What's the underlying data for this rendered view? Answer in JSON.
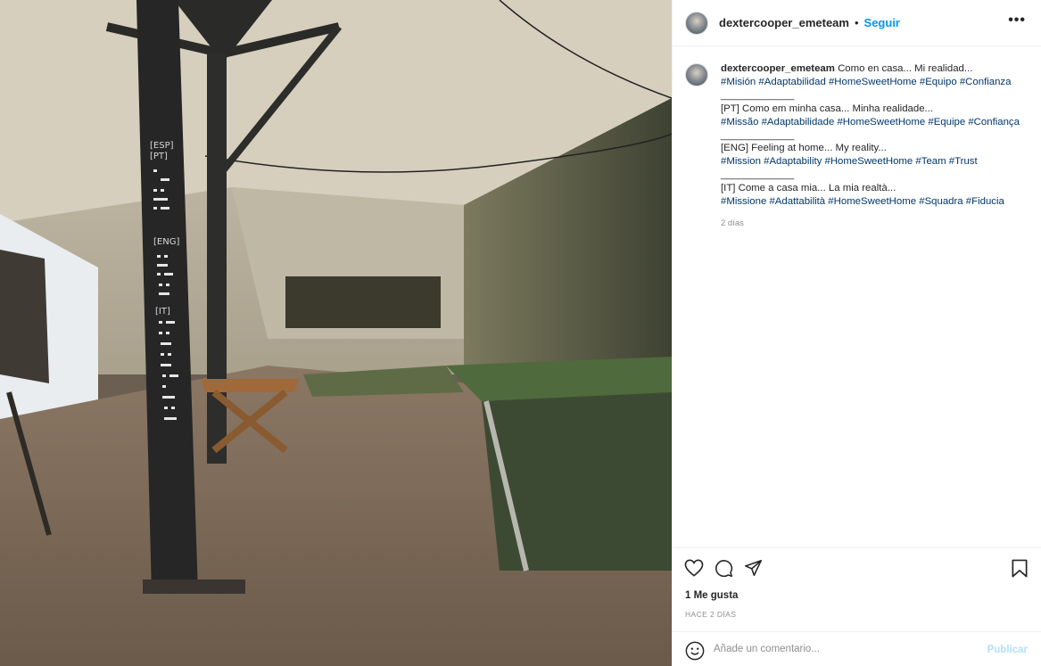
{
  "post": {
    "username": "dextercooper_emeteam",
    "separator": "•",
    "follow_label": "Seguir",
    "more_label": "•••",
    "photo_alt": "",
    "pillar_labels": [
      "[ESP]",
      "[PT]",
      "[ENG]",
      "[IT]"
    ]
  },
  "caption": {
    "username": "dextercooper_emeteam",
    "line_es": "Como en casa... Mi realidad...",
    "tags_es": "#Misión #Adaptabilidad #HomeSweetHome #Equipo #Confianza",
    "rule_1": "_____________",
    "line_pt": "[PT] Como em minha casa... Minha realidade...",
    "tags_pt": "#Missão #Adaptabilidade #HomeSweetHome #Equipe #Confiança",
    "rule_2": "_____________",
    "line_en": "[ENG] Feeling at home... My reality...",
    "tags_en": "#Mission #Adaptability #HomeSweetHome #Team #Trust",
    "rule_3": "_____________",
    "line_it": "[IT] Come a casa mia... La mia realtà...",
    "tags_it": "#Missione #Adattabilità #HomeSweetHome #Squadra #Fiducia",
    "time_ago": "2 días"
  },
  "actions": {
    "like_icon": "heart-icon",
    "comment_icon": "comment-icon",
    "share_icon": "paper-plane-icon",
    "save_icon": "bookmark-icon"
  },
  "likes": {
    "count_text": "1 Me gusta"
  },
  "timestamp": "HACE 2 DÍAS",
  "comment_box": {
    "placeholder": "Añade un comentario...",
    "post_label": "Publicar"
  },
  "colors": {
    "link": "#0095f6",
    "hashtag": "#00376b",
    "post_disabled": "#b2dffc",
    "muted": "#8e8e8e"
  }
}
